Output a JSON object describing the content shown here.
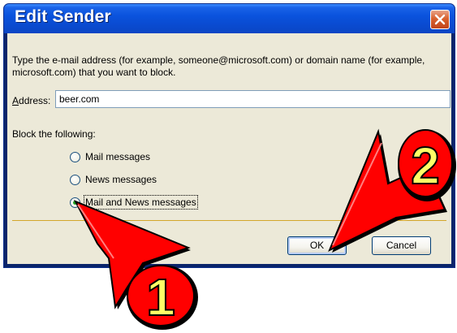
{
  "window": {
    "title": "Edit Sender",
    "close_icon": "close-icon"
  },
  "dialog": {
    "description": "Type the e-mail address (for example, someone@microsoft.com) or domain name (for example, microsoft.com) that you want to block.",
    "address_label": "Address:",
    "address_value": "beer.com",
    "block_label": "Block the following:",
    "options": [
      {
        "label": "Mail messages",
        "selected": false
      },
      {
        "label": "News messages",
        "selected": false
      },
      {
        "label": "Mail and News messages",
        "selected": true
      }
    ],
    "ok_label": "OK",
    "cancel_label": "Cancel"
  },
  "annotations": {
    "step1": "1",
    "step2": "2",
    "arrow_color": "#ff0000",
    "badge_color": "#ff0000",
    "digit_color": "#ffff66"
  }
}
